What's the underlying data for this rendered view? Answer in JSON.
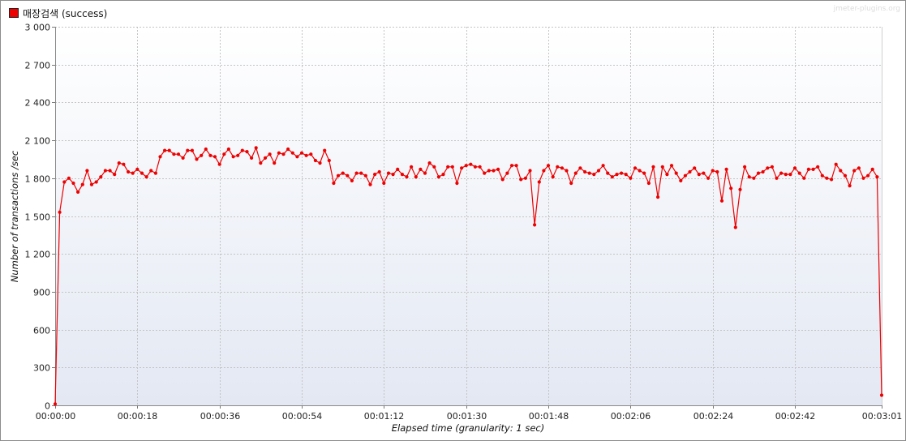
{
  "legend": {
    "label": "매장검색 (success)",
    "color": "#ee0000"
  },
  "watermark": "jmeter-plugins.org",
  "chart_data": {
    "type": "line",
    "xlabel": "Elapsed time (granularity: 1 sec)",
    "ylabel": "Number of transactions /sec",
    "ylim": [
      0,
      3000
    ],
    "y_ticks": [
      0,
      300,
      600,
      900,
      1200,
      1500,
      1800,
      2100,
      2400,
      2700,
      3000
    ],
    "y_tick_labels": [
      "0",
      "300",
      "600",
      "900",
      "1 200",
      "1 500",
      "1 800",
      "2 100",
      "2 400",
      "2 700",
      "3 000"
    ],
    "xlim_seconds": [
      0,
      181
    ],
    "x_ticks_seconds": [
      0,
      18,
      36,
      54,
      72,
      90,
      108,
      126,
      144,
      162,
      181
    ],
    "x_tick_labels": [
      "00:00:00",
      "00:00:18",
      "00:00:36",
      "00:00:54",
      "00:01:12",
      "00:01:30",
      "00:01:48",
      "00:02:06",
      "00:02:24",
      "00:02:42",
      "00:03:01"
    ],
    "grid": true,
    "legend_position": "top-left",
    "series": [
      {
        "name": "매장검색 (success)",
        "color": "#ee0000",
        "values": [
          10,
          1530,
          1770,
          1800,
          1760,
          1690,
          1750,
          1860,
          1750,
          1770,
          1810,
          1860,
          1860,
          1830,
          1920,
          1910,
          1850,
          1840,
          1870,
          1840,
          1810,
          1860,
          1840,
          1970,
          2020,
          2020,
          1990,
          1990,
          1960,
          2020,
          2020,
          1950,
          1980,
          2030,
          1980,
          1970,
          1910,
          1990,
          2030,
          1970,
          1980,
          2020,
          2010,
          1960,
          2040,
          1920,
          1960,
          1990,
          1920,
          2000,
          1990,
          2030,
          2000,
          1970,
          2000,
          1980,
          1990,
          1940,
          1920,
          2020,
          1940,
          1760,
          1820,
          1840,
          1820,
          1780,
          1840,
          1840,
          1820,
          1750,
          1830,
          1850,
          1760,
          1840,
          1830,
          1870,
          1830,
          1810,
          1890,
          1810,
          1870,
          1840,
          1920,
          1890,
          1810,
          1830,
          1890,
          1890,
          1760,
          1880,
          1900,
          1910,
          1890,
          1890,
          1840,
          1860,
          1860,
          1870,
          1790,
          1840,
          1900,
          1900,
          1790,
          1800,
          1860,
          1430,
          1770,
          1860,
          1900,
          1810,
          1890,
          1880,
          1860,
          1760,
          1840,
          1880,
          1850,
          1840,
          1830,
          1860,
          1900,
          1840,
          1810,
          1830,
          1840,
          1830,
          1800,
          1880,
          1860,
          1840,
          1760,
          1890,
          1650,
          1890,
          1830,
          1900,
          1840,
          1780,
          1820,
          1850,
          1880,
          1830,
          1840,
          1800,
          1860,
          1850,
          1620,
          1870,
          1720,
          1410,
          1710,
          1890,
          1810,
          1800,
          1840,
          1850,
          1880,
          1890,
          1800,
          1840,
          1830,
          1830,
          1880,
          1840,
          1800,
          1870,
          1870,
          1890,
          1820,
          1800,
          1790,
          1910,
          1860,
          1820,
          1740,
          1860,
          1880,
          1800,
          1820,
          1870,
          1810,
          80
        ]
      }
    ]
  }
}
